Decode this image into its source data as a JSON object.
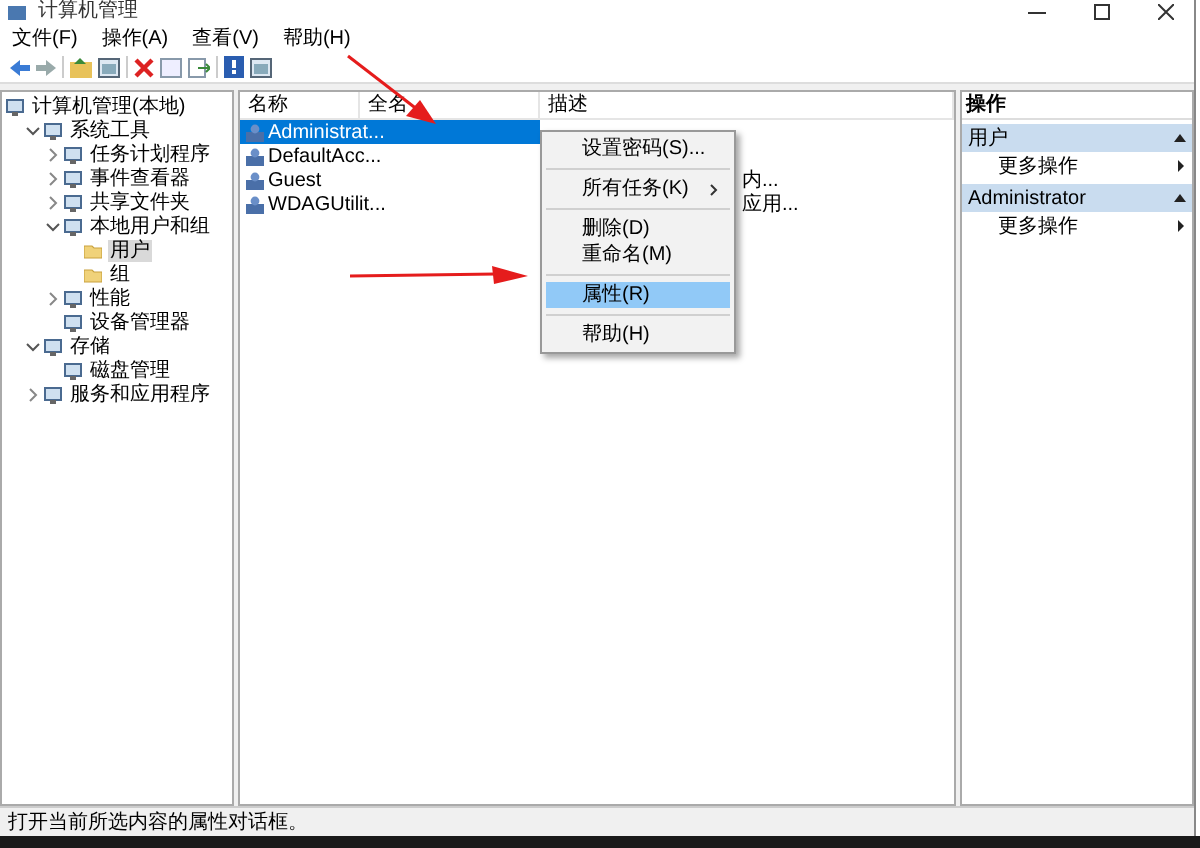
{
  "window": {
    "title": "计算机管理"
  },
  "menu": [
    "文件(F)",
    "操作(A)",
    "查看(V)",
    "帮助(H)"
  ],
  "tree": [
    {
      "label": "计算机管理(本地)",
      "kind": "node",
      "selected": false,
      "children": [
        {
          "label": "系统工具",
          "kind": "node",
          "expanded": true,
          "selected": false,
          "children": [
            {
              "label": "任务计划程序",
              "kind": "node",
              "expanded": false,
              "selected": false
            },
            {
              "label": "事件查看器",
              "kind": "node",
              "expanded": false,
              "selected": false
            },
            {
              "label": "共享文件夹",
              "kind": "node",
              "expanded": false,
              "selected": false
            },
            {
              "label": "本地用户和组",
              "kind": "node",
              "expanded": true,
              "selected": false,
              "children": [
                {
                  "label": "用户",
                  "kind": "folder",
                  "selected": true
                },
                {
                  "label": "组",
                  "kind": "folder",
                  "selected": false
                }
              ]
            },
            {
              "label": "性能",
              "kind": "node",
              "expanded": false,
              "selected": false
            },
            {
              "label": "设备管理器",
              "kind": "node",
              "selected": false
            }
          ]
        },
        {
          "label": "存储",
          "kind": "node",
          "expanded": true,
          "selected": false,
          "children": [
            {
              "label": "磁盘管理",
              "kind": "node",
              "selected": false
            }
          ]
        },
        {
          "label": "服务和应用程序",
          "kind": "node",
          "expanded": false,
          "selected": false
        }
      ]
    }
  ],
  "table": {
    "columns": [
      "名称",
      "全名",
      "描述"
    ],
    "rows": [
      {
        "name": "Administrat...",
        "selected": true
      },
      {
        "name": "DefaultAcc...",
        "selected": false
      },
      {
        "name": "Guest",
        "description": "内...",
        "selected": false
      },
      {
        "name": "WDAGUtilit...",
        "description": "应用...",
        "selected": false
      }
    ]
  },
  "context_menu": [
    [
      {
        "label": "设置密码(S)...",
        "selected": false
      }
    ],
    [
      {
        "label": "所有任务(K)",
        "submenu": true,
        "selected": false
      }
    ],
    [
      {
        "label": "删除(D)",
        "selected": false
      },
      {
        "label": "重命名(M)",
        "selected": false
      }
    ],
    [
      {
        "label": "属性(R)",
        "selected": true
      }
    ],
    [
      {
        "label": "帮助(H)",
        "selected": false
      }
    ]
  ],
  "actions": {
    "title": "操作",
    "sections": [
      {
        "title": "用户",
        "items": [
          "更多操作"
        ]
      },
      {
        "title": "Administrator",
        "items": [
          "更多操作"
        ]
      }
    ]
  },
  "status_bar": "打开当前所选内容的属性对话框。"
}
